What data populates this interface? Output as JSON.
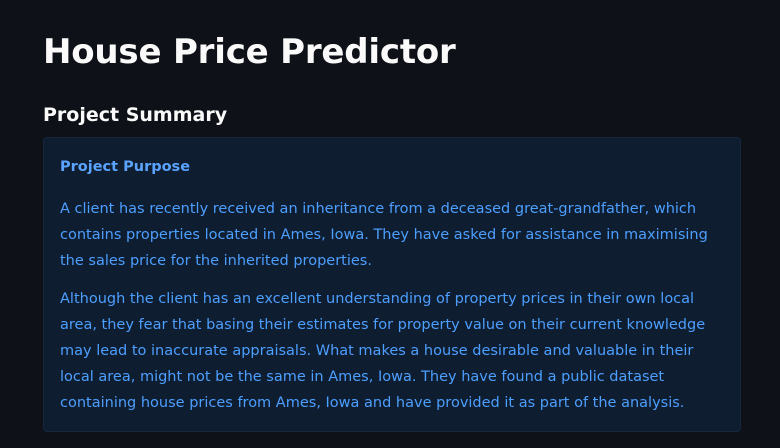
{
  "page": {
    "title": "House Price Predictor"
  },
  "summary": {
    "heading": "Project Summary",
    "box": {
      "heading": "Project Purpose",
      "paragraphs": [
        "A client has recently received an inheritance from a deceased great-grandfather, which contains properties located in Ames, Iowa. They have asked for assistance in maximising the sales price for the inherited properties.",
        "Although the client has an excellent understanding of property prices in their own local area, they fear that basing their estimates for property value on their current knowledge may lead to inaccurate appraisals. What makes a house desirable and valuable in their local area, might not be the same in Ames, Iowa. They have found a public dataset containing house prices from Ames, Iowa and have provided it as part of the analysis."
      ]
    }
  },
  "colors": {
    "background": "#0e1117",
    "text": "#fafafa",
    "info_bg": "#0f1d30",
    "info_text": "#4c9fff"
  }
}
